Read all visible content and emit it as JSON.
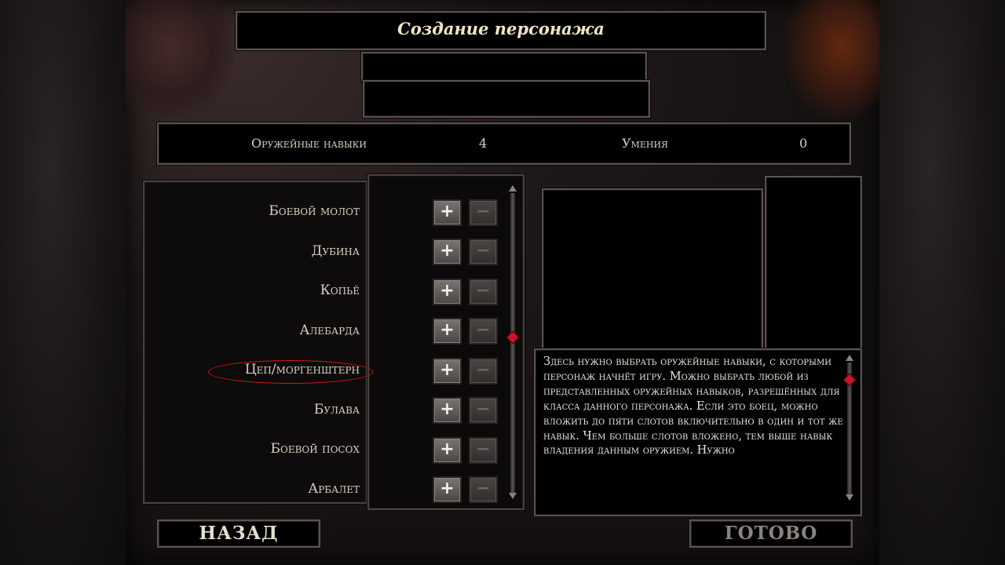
{
  "window": {
    "title": "Создание персонажа"
  },
  "stats": {
    "weapon_skills_label": "Оружейные навыки",
    "weapon_skills_value": "4",
    "abilities_label": "Умения",
    "abilities_value": "0"
  },
  "skills": [
    {
      "label": "Боевой молот"
    },
    {
      "label": "Дубина"
    },
    {
      "label": "Копьё"
    },
    {
      "label": "Алебарда"
    },
    {
      "label": "Цеп/моргенштерн",
      "highlighted": true
    },
    {
      "label": "Булава"
    },
    {
      "label": "Боевой посох"
    },
    {
      "label": "Арбалет"
    }
  ],
  "buttons": {
    "plus": "+",
    "minus": "−"
  },
  "description": "Здесь нужно выбрать оружейные навыки, с которыми персонаж начнёт игру. Можно выбрать любой из представленных оружейных навыков, разрешённых для класса данного персонажа. Если это боец, можно вложить до пяти слотов включительно в один и тот же навык. Чем больше слотов вложено, тем выше навык владения данным оружием. Нужно",
  "footer": {
    "back_label": "НАЗАД",
    "done_label": "ГОТОВО"
  },
  "colors": {
    "highlight": "#cc1a1a",
    "scroll_thumb": "#c8142a"
  }
}
